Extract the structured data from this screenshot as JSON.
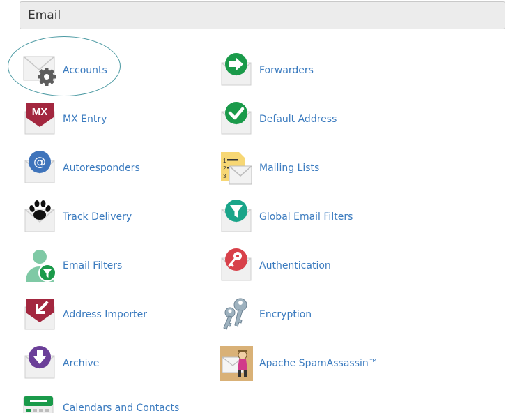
{
  "section": {
    "title": "Email"
  },
  "items": [
    {
      "label": "Accounts",
      "icon": "email-accounts-icon"
    },
    {
      "label": "Forwarders",
      "icon": "forwarders-icon"
    },
    {
      "label": "MX Entry",
      "icon": "mx-entry-icon"
    },
    {
      "label": "Default Address",
      "icon": "default-address-icon"
    },
    {
      "label": "Autoresponders",
      "icon": "autoresponders-icon"
    },
    {
      "label": "Mailing Lists",
      "icon": "mailing-lists-icon"
    },
    {
      "label": "Track Delivery",
      "icon": "track-delivery-icon"
    },
    {
      "label": "Global Email Filters",
      "icon": "global-email-filters-icon"
    },
    {
      "label": "Email Filters",
      "icon": "email-filters-icon"
    },
    {
      "label": "Authentication",
      "icon": "authentication-icon"
    },
    {
      "label": "Address Importer",
      "icon": "address-importer-icon"
    },
    {
      "label": "Encryption",
      "icon": "encryption-icon"
    },
    {
      "label": "Archive",
      "icon": "archive-icon"
    },
    {
      "label": "Apache SpamAssassin™",
      "icon": "spamassassin-icon"
    },
    {
      "label": "Calendars and Contacts",
      "icon": "calendars-contacts-icon"
    }
  ],
  "colors": {
    "link": "#3b7bbf",
    "green": "#1a9a4a",
    "maroon": "#a3273f",
    "blue": "#3f74bb",
    "teal": "#1aa58a",
    "red": "#d8414a",
    "purple": "#6b3f98",
    "highlight": "#4c9aa3"
  }
}
